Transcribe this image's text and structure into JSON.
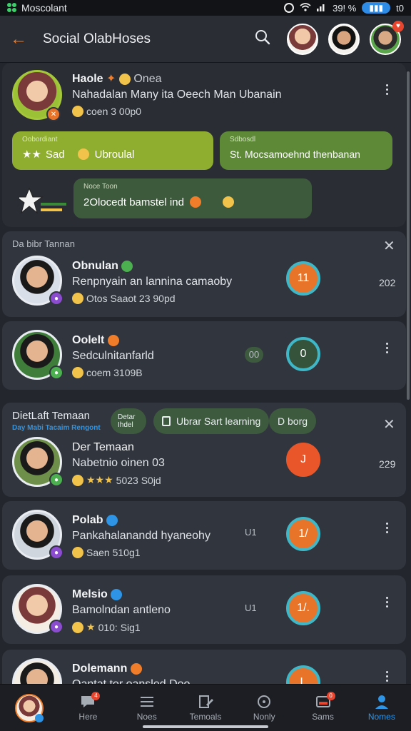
{
  "status_bar": {
    "carrier": "Moscolant",
    "battery_text": "39! %",
    "right_text": "t0"
  },
  "app_bar": {
    "back_icon": "arrow-left-icon",
    "title": "Social OlabHoses",
    "search_icon": "search-icon"
  },
  "top_card": {
    "name": "Haole",
    "name_suffix": "Onea",
    "subtitle": "Nahadalan Many ita Oeech Man Ubanain",
    "meta": "coen 3 00p0",
    "bubbles": [
      {
        "caption": "Oobordiant",
        "text": "Sad",
        "text2": "Ubroulal",
        "color": "#8fae2f"
      },
      {
        "caption": "Sdbosdl",
        "text": "St. Mocsamoehnd thenbanan",
        "color": "#5e8a38"
      },
      {
        "caption": "Noce Toon",
        "text": "2Olocedt bamstel ind",
        "color": "#3e5a3c"
      }
    ]
  },
  "section1": {
    "header": "Da bibr Tannan",
    "items": [
      {
        "name": "Obnulan",
        "subtitle": "Renpnyain an lannina camaoby",
        "meta": "Otos Saaot 23 90pd",
        "ring_value": "11",
        "count": "202",
        "ring_color": "#e8742a"
      },
      {
        "name": "Oolelt",
        "subtitle": "Sedculnitanfarld",
        "meta": "coem 3109B",
        "ring_value": "0",
        "count": "",
        "ring_color": "#35523a",
        "side_tag": "00"
      }
    ]
  },
  "section2": {
    "header": "DietLaft Temaan",
    "subheader": "Day Mabi Tacaim Rengont",
    "chips": [
      {
        "label": "Detar Ihdel"
      },
      {
        "label": "Ubrar Sart learning"
      },
      {
        "label": "D borg"
      }
    ],
    "items": [
      {
        "name": "Der Temaan",
        "subtitle": "Nabetnio oinen 03",
        "meta": "5023 S0jd",
        "ring_value": "J",
        "count": "229",
        "ring_color": "#e8562a",
        "solid": true
      },
      {
        "name": "Polab",
        "subtitle": "Pankahalanandd hyaneohy",
        "meta": "Saen 510g1",
        "ring_value": "1/",
        "count": "",
        "ring_color": "#e8742a",
        "side_tag": "U1"
      },
      {
        "name": "Melsio",
        "subtitle": "Bamolndan antleno",
        "meta": "010: Sig1",
        "ring_value": "1/.",
        "count": "",
        "ring_color": "#e8742a",
        "side_tag": "U1"
      },
      {
        "name": "Dolemann",
        "subtitle": "Oantat tor oansled Doo",
        "meta": "",
        "ring_value": "L",
        "count": "",
        "ring_color": "#e8742a"
      }
    ]
  },
  "bottom_nav": {
    "tabs": [
      {
        "label": "",
        "icon": "profile-avatar-icon"
      },
      {
        "label": "Here",
        "icon": "chat-icon",
        "badge": "4"
      },
      {
        "label": "Noes",
        "icon": "list-icon"
      },
      {
        "label": "Temoals",
        "icon": "edit-icon"
      },
      {
        "label": "Nonly",
        "icon": "compass-icon"
      },
      {
        "label": "Sams",
        "icon": "inbox-icon",
        "badge": "0"
      },
      {
        "label": "Nomes",
        "icon": "person-icon",
        "active": true
      }
    ]
  },
  "colors": {
    "accent": "#f07d2a",
    "teal": "#3fb7c7",
    "nav_active": "#2e95e6",
    "green": "#8fae2f"
  }
}
